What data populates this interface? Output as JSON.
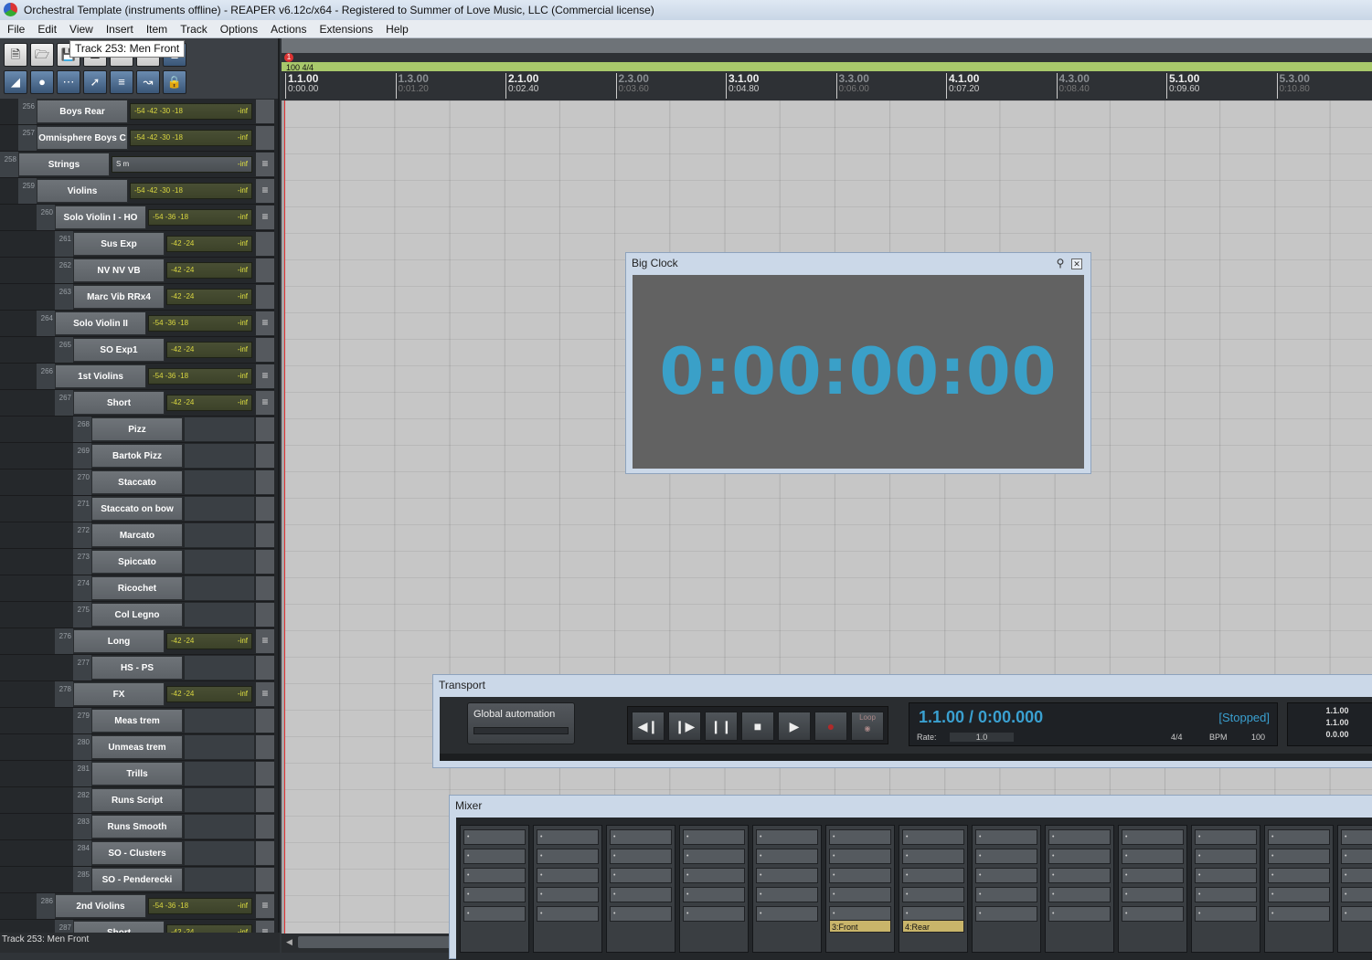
{
  "window": {
    "title": "Orchestral Template (instruments offline) - REAPER v6.12c/x64 - Registered to Summer of Love Music, LLC (Commercial license)"
  },
  "menu": [
    "File",
    "Edit",
    "View",
    "Insert",
    "Item",
    "Track",
    "Options",
    "Actions",
    "Extensions",
    "Help"
  ],
  "tooltip": "Track 253: Men Front",
  "tracks": [
    {
      "num": "256",
      "name": "Boys Rear",
      "meter": "-54  -42  -30  -18",
      "inf": "-inf"
    },
    {
      "num": "257",
      "name": "Omnisphere Boys C",
      "meter": "-54  -42  -30  -18",
      "inf": "-inf"
    },
    {
      "num": "258",
      "name": "Strings",
      "meter": "S   m",
      "inf": "-inf"
    },
    {
      "num": "259",
      "name": "Violins",
      "meter": "-54  -42  -30  -18",
      "inf": "-inf"
    },
    {
      "num": "260",
      "name": "Solo Violin I - HO",
      "meter": "-54   -36   -18",
      "inf": "-inf"
    },
    {
      "num": "261",
      "name": "Sus Exp",
      "meter": "-42   -24",
      "inf": "-inf"
    },
    {
      "num": "262",
      "name": "NV NV VB",
      "meter": "-42   -24",
      "inf": "-inf"
    },
    {
      "num": "263",
      "name": "Marc Vib RRx4",
      "meter": "-42   -24",
      "inf": "-inf"
    },
    {
      "num": "264",
      "name": "Solo Violin II",
      "meter": "-54   -36   -18",
      "inf": "-inf"
    },
    {
      "num": "265",
      "name": "SO Exp1",
      "meter": "-42   -24",
      "inf": "-inf"
    },
    {
      "num": "266",
      "name": "1st Violins",
      "meter": "-54   -36   -18",
      "inf": "-inf"
    },
    {
      "num": "267",
      "name": "Short",
      "meter": "-42   -24",
      "inf": "-inf"
    },
    {
      "num": "268",
      "name": "Pizz",
      "meter": "",
      "inf": ""
    },
    {
      "num": "269",
      "name": "Bartok Pizz",
      "meter": "",
      "inf": ""
    },
    {
      "num": "270",
      "name": "Staccato",
      "meter": "",
      "inf": ""
    },
    {
      "num": "271",
      "name": "Staccato on bow",
      "meter": "",
      "inf": ""
    },
    {
      "num": "272",
      "name": "Marcato",
      "meter": "",
      "inf": ""
    },
    {
      "num": "273",
      "name": "Spiccato",
      "meter": "",
      "inf": ""
    },
    {
      "num": "274",
      "name": "Ricochet",
      "meter": "",
      "inf": ""
    },
    {
      "num": "275",
      "name": "Col Legno",
      "meter": "",
      "inf": ""
    },
    {
      "num": "276",
      "name": "Long",
      "meter": "-42   -24",
      "inf": "-inf"
    },
    {
      "num": "277",
      "name": "HS - PS",
      "meter": "",
      "inf": ""
    },
    {
      "num": "278",
      "name": "FX",
      "meter": "-42   -24",
      "inf": "-inf"
    },
    {
      "num": "279",
      "name": "Meas trem",
      "meter": "",
      "inf": ""
    },
    {
      "num": "280",
      "name": "Unmeas trem",
      "meter": "",
      "inf": ""
    },
    {
      "num": "281",
      "name": "Trills",
      "meter": "",
      "inf": ""
    },
    {
      "num": "282",
      "name": "Runs Script",
      "meter": "",
      "inf": ""
    },
    {
      "num": "283",
      "name": "Runs Smooth",
      "meter": "",
      "inf": ""
    },
    {
      "num": "284",
      "name": "SO - Clusters",
      "meter": "",
      "inf": ""
    },
    {
      "num": "285",
      "name": "SO - Penderecki",
      "meter": "",
      "inf": ""
    },
    {
      "num": "286",
      "name": "2nd Violins",
      "meter": "-54   -36   -18",
      "inf": "-inf"
    },
    {
      "num": "287",
      "name": "Short",
      "meter": "-42   -24",
      "inf": "-inf"
    }
  ],
  "status_left": "Track 253: Men Front",
  "ruler": {
    "tempo": "100 4/4",
    "marker": "1",
    "markers": [
      {
        "bar": "1.1.00",
        "time": "0:00.00"
      },
      {
        "bar": "1.3.00",
        "time": "0:01.20"
      },
      {
        "bar": "2.1.00",
        "time": "0:02.40"
      },
      {
        "bar": "2.3.00",
        "time": "0:03.60"
      },
      {
        "bar": "3.1.00",
        "time": "0:04.80"
      },
      {
        "bar": "3.3.00",
        "time": "0:06.00"
      },
      {
        "bar": "4.1.00",
        "time": "0:07.20"
      },
      {
        "bar": "4.3.00",
        "time": "0:08.40"
      },
      {
        "bar": "5.1.00",
        "time": "0:09.60"
      },
      {
        "bar": "5.3.00",
        "time": "0:10.80"
      }
    ]
  },
  "bigclock": {
    "title": "Big Clock",
    "time": "0:00:00:00"
  },
  "transport": {
    "title": "Transport",
    "automation": "Global automation",
    "loop": "Loop",
    "position": "1.1.00 / 0:00.000",
    "state": "[Stopped]",
    "rate_label": "Rate:",
    "rate": "1.0",
    "timesig": "4/4",
    "bpm_label": "BPM",
    "bpm": "100",
    "sel1": "1.1.00",
    "sel2": "1.1.00",
    "sel3": "0.0.00"
  },
  "mixer": {
    "title": "Mixer",
    "bus1": "3:Front",
    "bus2": "4:Rear"
  }
}
